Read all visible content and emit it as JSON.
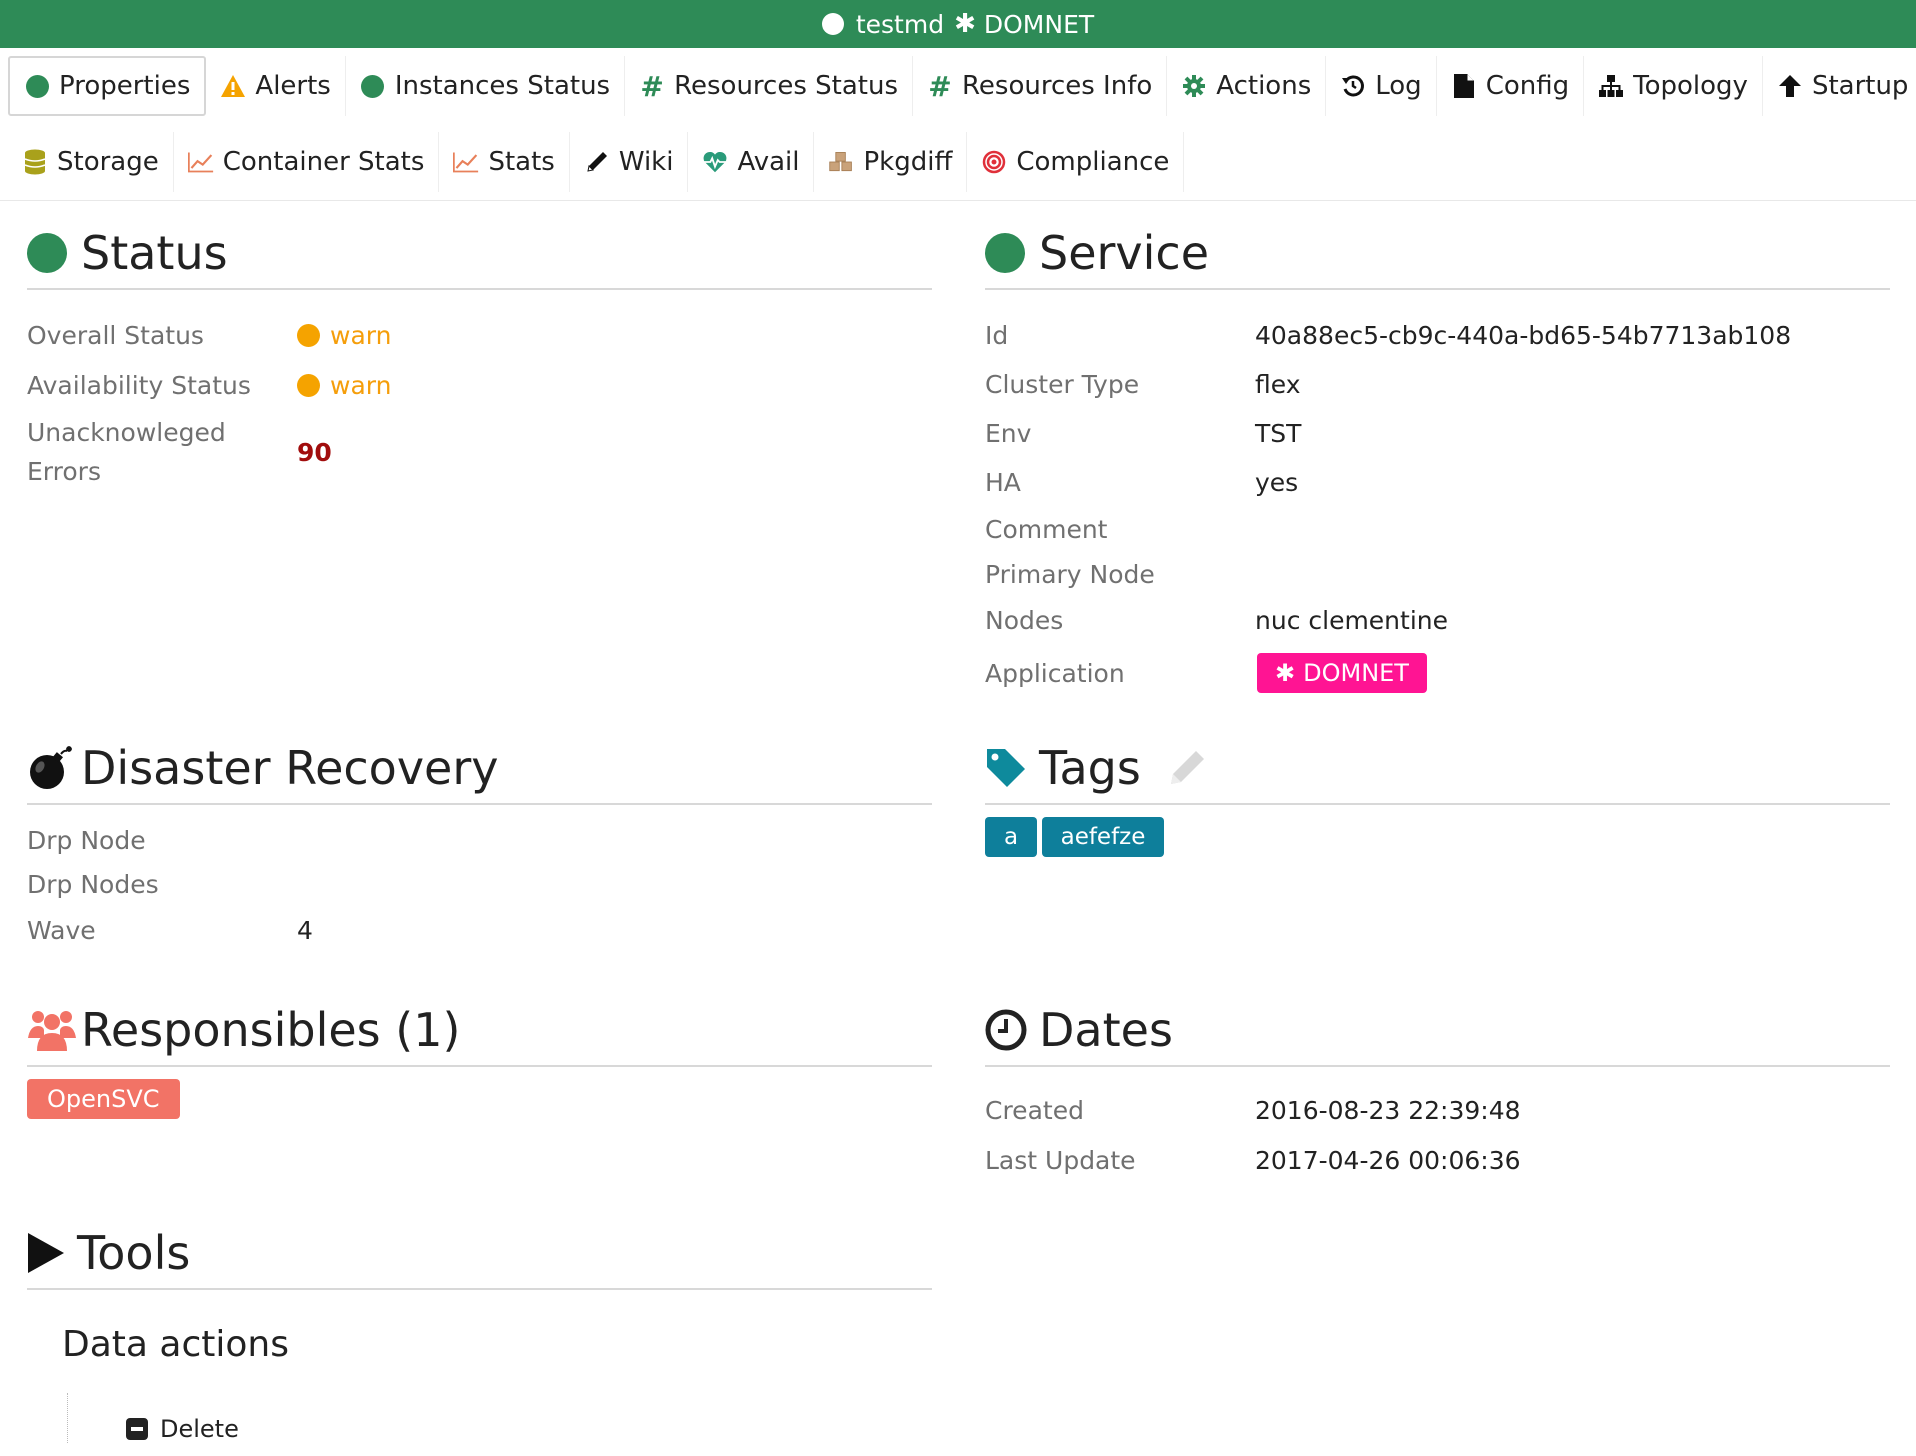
{
  "titlebar": {
    "service_name": "testmd",
    "app_name": "DOMNET"
  },
  "tabs_row1": [
    {
      "label": "Properties",
      "icon": "status-dot-icon"
    },
    {
      "label": "Alerts",
      "icon": "warning-icon"
    },
    {
      "label": "Instances Status",
      "icon": "status-dot-icon"
    },
    {
      "label": "Resources Status",
      "icon": "hash-icon"
    },
    {
      "label": "Resources Info",
      "icon": "hash-icon"
    },
    {
      "label": "Actions",
      "icon": "gear-icon"
    },
    {
      "label": "Log",
      "icon": "history-icon"
    },
    {
      "label": "Config",
      "icon": "file-icon"
    },
    {
      "label": "Topology",
      "icon": "sitemap-icon"
    },
    {
      "label": "Startup",
      "icon": "arrow-up-icon"
    }
  ],
  "tabs_row2": [
    {
      "label": "Storage",
      "icon": "database-icon"
    },
    {
      "label": "Container Stats",
      "icon": "chart-icon"
    },
    {
      "label": "Stats",
      "icon": "chart-icon"
    },
    {
      "label": "Wiki",
      "icon": "pencil-icon"
    },
    {
      "label": "Avail",
      "icon": "heartbeat-icon"
    },
    {
      "label": "Pkgdiff",
      "icon": "cubes-icon"
    },
    {
      "label": "Compliance",
      "icon": "target-icon"
    }
  ],
  "status": {
    "title": "Status",
    "overall_label": "Overall Status",
    "overall_value": "warn",
    "availability_label": "Availability Status",
    "availability_value": "warn",
    "errors_label_line1": "Unacknowleged",
    "errors_label_line2": "Errors",
    "errors_value": "90"
  },
  "service": {
    "title": "Service",
    "id_label": "Id",
    "id_value": "40a88ec5-cb9c-440a-bd65-54b7713ab108",
    "cluster_label": "Cluster Type",
    "cluster_value": "flex",
    "env_label": "Env",
    "env_value": "TST",
    "ha_label": "HA",
    "ha_value": "yes",
    "comment_label": "Comment",
    "primary_label": "Primary Node",
    "nodes_label": "Nodes",
    "nodes_value": "nuc clementine",
    "application_label": "Application",
    "application_value": "DOMNET"
  },
  "drp": {
    "title": "Disaster Recovery",
    "drp_node_label": "Drp Node",
    "drp_nodes_label": "Drp Nodes",
    "wave_label": "Wave",
    "wave_value": "4"
  },
  "tags": {
    "title": "Tags",
    "items": [
      "a",
      "aefefze"
    ]
  },
  "responsibles": {
    "title": "Responsibles (1)",
    "items": [
      "OpenSVC"
    ]
  },
  "dates": {
    "title": "Dates",
    "created_label": "Created",
    "created_value": "2016-08-23 22:39:48",
    "updated_label": "Last Update",
    "updated_value": "2017-04-26 00:06:36"
  },
  "tools": {
    "title": "Tools",
    "subtitle": "Data actions",
    "delete_label": "Delete"
  },
  "colors": {
    "green": "#2e8b57",
    "warn": "#f5a300",
    "error": "#a10d0d",
    "app": "#ff1493",
    "tag": "#0e7f9b",
    "responsible": "#f27366"
  }
}
